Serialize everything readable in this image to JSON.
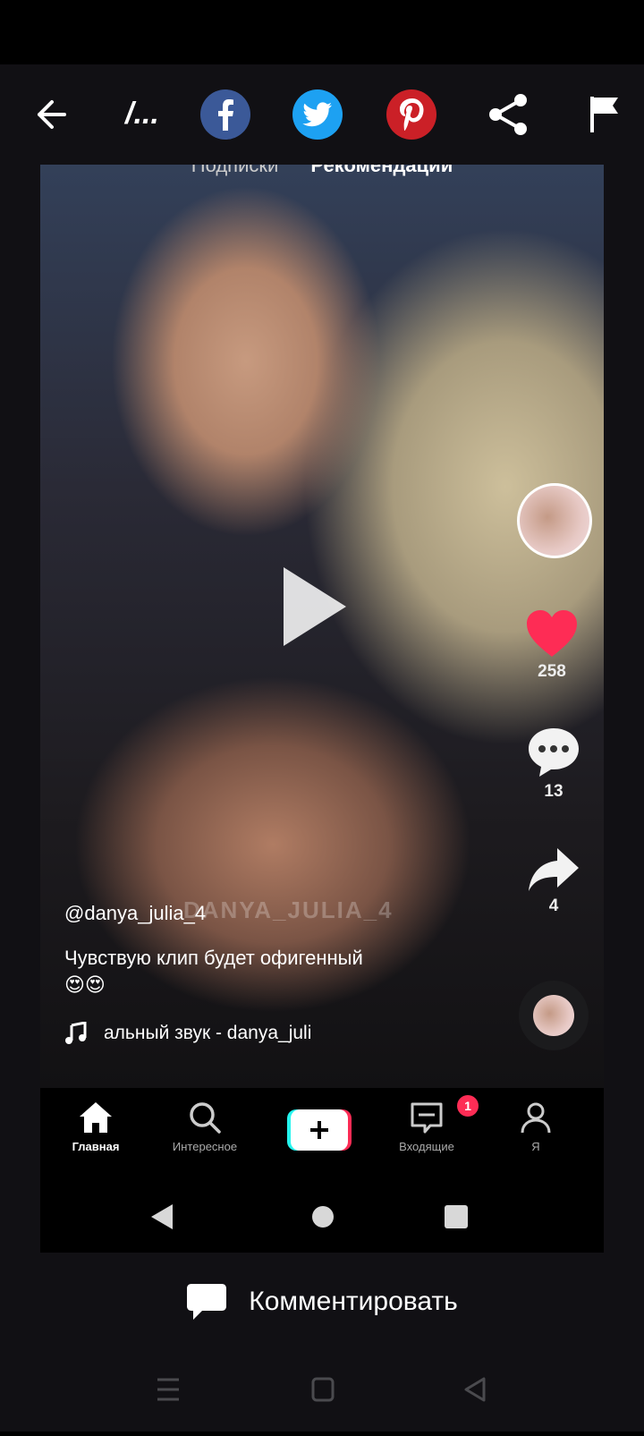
{
  "app_bar": {
    "title": "/...",
    "icons": [
      "back-arrow-icon",
      "facebook-icon",
      "twitter-icon",
      "pinterest-icon",
      "share-icon",
      "flag-icon"
    ]
  },
  "video": {
    "top_tabs": {
      "following": "Подписки",
      "for_you": "Рекомендации"
    },
    "watermark": "DANYA_JULIA_4",
    "username": "@danya_julia_4",
    "caption": "Чувствую клип будет офигенный",
    "caption_emoji": "😍😍",
    "sound": "альный звук - danya_juli",
    "likes": "258",
    "comments": "13",
    "shares": "4"
  },
  "tiktok_nav": {
    "home": "Главная",
    "discover": "Интересное",
    "inbox": "Входящие",
    "inbox_badge": "1",
    "profile": "Я"
  },
  "comment_bar": {
    "label": "Комментировать"
  },
  "colors": {
    "like": "#fe2c55",
    "facebook": "#3b5998",
    "twitter": "#1da1f2",
    "pinterest": "#cb2027"
  }
}
